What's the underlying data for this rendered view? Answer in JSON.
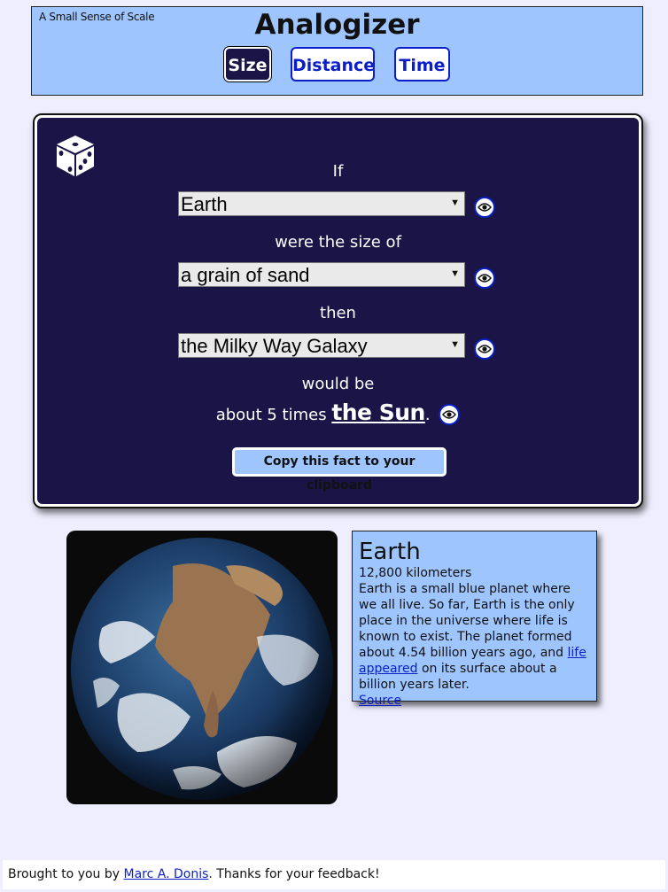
{
  "header": {
    "tagline": "A Small Sense of Scale",
    "title": "Analogizer",
    "tabs": [
      {
        "label": "Size",
        "active": true
      },
      {
        "label": "Distance",
        "active": false
      },
      {
        "label": "Time",
        "active": false
      }
    ]
  },
  "panel": {
    "dice_icon": "dice-icon",
    "if_text": "If",
    "select1": "Earth",
    "were_text": "were the size of",
    "select2": "a grain of sand",
    "then_text": "then",
    "select3": "the Milky Way Galaxy",
    "would_text": "would be",
    "result_prefix": "about 5 times ",
    "result_link": "the Sun",
    "result_suffix": ".",
    "copy_button": "Copy this fact to your clipboard"
  },
  "info": {
    "title": "Earth",
    "size": "12,800 kilometers",
    "desc_part1": "Earth is a small blue planet where we all live. So far, Earth is the only place in the universe where life is known to exist. The planet formed about 4.54 billion years ago, and ",
    "desc_link": "life appeared",
    "desc_part2": " on its surface about a billion years later.",
    "source_link": "Source"
  },
  "footer": {
    "prefix": "Brought to you by ",
    "author": "Marc A. Donis",
    "suffix": ". Thanks for your feedback!"
  },
  "colors": {
    "background": "#eeeefe",
    "header_bg": "#9ec5fe",
    "panel_bg": "#1a1447",
    "link": "#0b1fc9"
  }
}
